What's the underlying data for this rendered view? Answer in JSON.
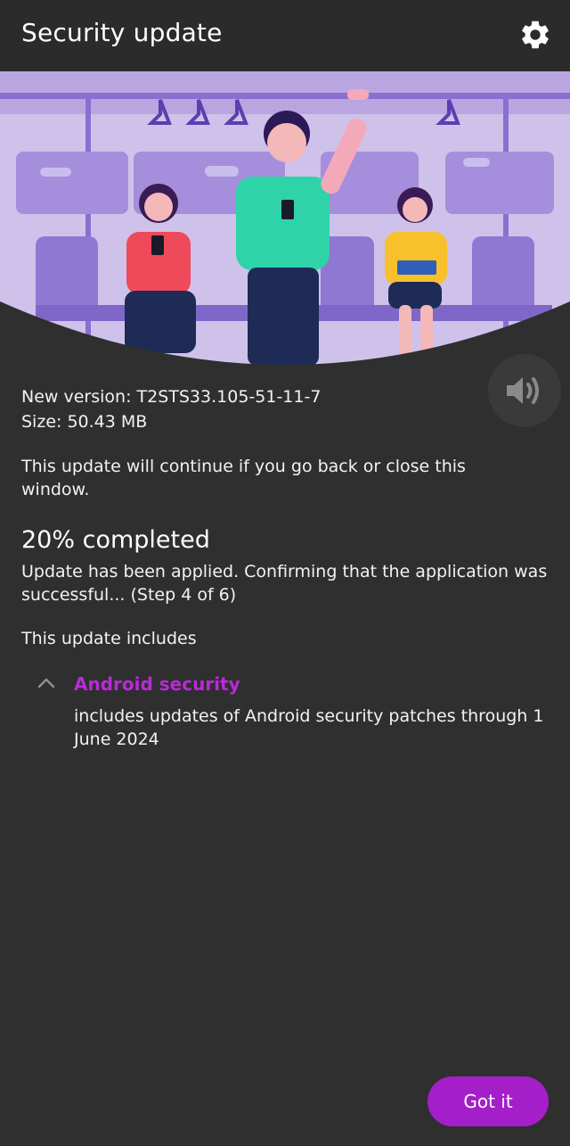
{
  "header": {
    "title": "Security update",
    "settings_icon": "gear-icon"
  },
  "sound_button": {
    "icon": "speaker-icon"
  },
  "update": {
    "version_line": "New version: T2STS33.105-51-11-7",
    "size_line": "Size: 50.43 MB",
    "continue_notice": "This update will continue if you go back or close this window."
  },
  "progress": {
    "percent": 20,
    "title": "20% completed",
    "description": "Update has been applied. Confirming that the application was successful... (Step 4 of 6)"
  },
  "includes": {
    "heading": "This update includes",
    "items": [
      {
        "title": "Android security",
        "description": "includes updates of Android security patches through 1 June 2024",
        "expanded": true
      }
    ]
  },
  "actions": {
    "got_it_label": "Got it"
  },
  "colors": {
    "background": "#2f2f2f",
    "topbar": "#2b2b2b",
    "accent": "#a41fc9",
    "accent_text": "#b82ad7"
  }
}
